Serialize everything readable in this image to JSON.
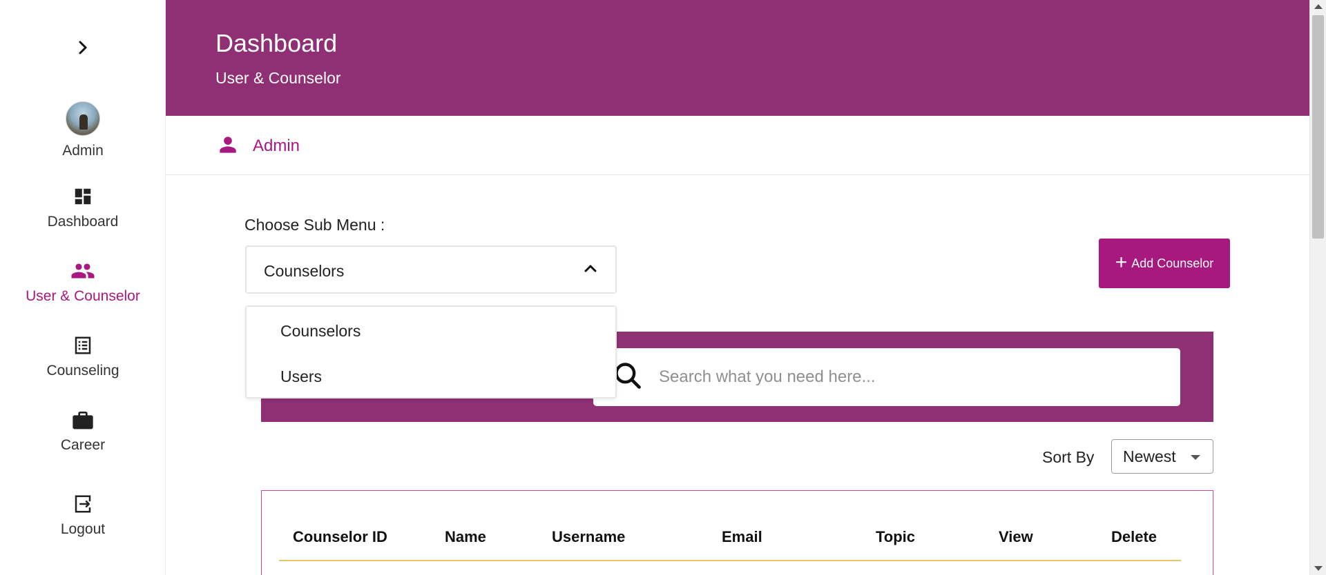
{
  "sidebar": {
    "items": [
      {
        "label": "Admin"
      },
      {
        "label": "Dashboard"
      },
      {
        "label": "User & Counselor"
      },
      {
        "label": "Counseling"
      },
      {
        "label": "Career"
      },
      {
        "label": "Logout"
      }
    ],
    "active_color": "#a8197f"
  },
  "header": {
    "title": "Dashboard",
    "subtitle": "User & Counselor",
    "background": "#8e3073"
  },
  "admin_bar": {
    "label": "Admin"
  },
  "submenu": {
    "label": "Choose Sub Menu :",
    "selected": "Counselors",
    "options": [
      "Counselors",
      "Users"
    ]
  },
  "add_button": {
    "label": "Add Counselor"
  },
  "search": {
    "placeholder": "Search what you need here..."
  },
  "sort": {
    "label": "Sort By",
    "selected": "Newest"
  },
  "table": {
    "columns": [
      "Counselor ID",
      "Name",
      "Username",
      "Email",
      "Topic",
      "View",
      "Delete"
    ]
  }
}
